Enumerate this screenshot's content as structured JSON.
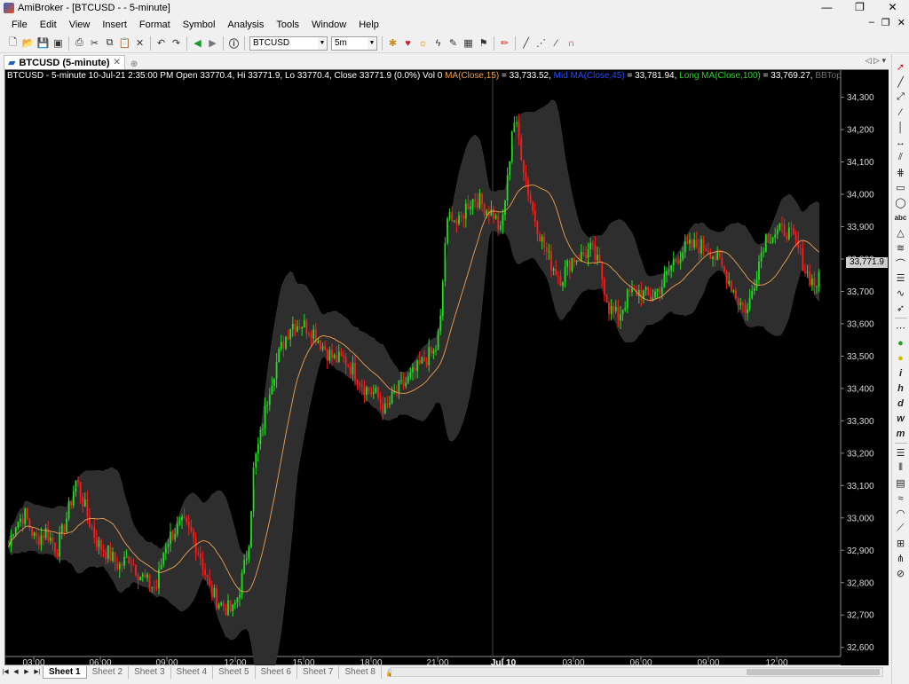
{
  "window": {
    "title": "AmiBroker - [BTCUSD - - 5-minute]",
    "minimize": "—",
    "restore": "❐",
    "close": "✕"
  },
  "menu": [
    "File",
    "Edit",
    "View",
    "Insert",
    "Format",
    "Symbol",
    "Analysis",
    "Tools",
    "Window",
    "Help"
  ],
  "toolbar": {
    "symbol": "BTCUSD",
    "interval": "5m"
  },
  "doc_tab": {
    "label": "BTCUSD (5-minute)"
  },
  "chart_header": {
    "main": "BTCUSD - 5-minute 10-Jul-21 2:35:00 PM Open 33770.4, Hi 33771.9, Lo 33770.4, Close 33771.9 (0.0%) Vol 0 ",
    "ma_label": "MA(Close,15)",
    "ma_value": " = 33,733.52, ",
    "mid_label": "Mid MA(Close,45)",
    "mid_value": " = 33,781.94, ",
    "long_label": "Long MA(Close,100)",
    "long_value": " = 33,769.27, ",
    "bb_label": "BBTop(Clos",
    "colors": {
      "main": "#ffffff",
      "ma": "#f0a050",
      "mid": "#2a4cff",
      "long": "#30d030",
      "bb": "#707070"
    }
  },
  "price_tag": "33,771.9",
  "chart_data": {
    "type": "candlestick",
    "symbol": "BTCUSD",
    "interval": "5-minute",
    "y_ticks": [
      "34,300",
      "34,200",
      "34,100",
      "34,000",
      "33,900",
      "33,800",
      "33,700",
      "33,600",
      "33,500",
      "33,400",
      "33,300",
      "33,200",
      "33,100",
      "33,000",
      "32,900",
      "32,800",
      "32,700",
      "32,600"
    ],
    "ylim": [
      32580,
      34340
    ],
    "x_ticks": [
      "03:00",
      "06:00",
      "09:00",
      "12:00",
      "15:00",
      "18:00",
      "21:00",
      "Jul 10",
      "03:00",
      "06:00",
      "09:00",
      "12:00"
    ],
    "close_path": [
      [
        0,
        32870
      ],
      [
        10,
        32980
      ],
      [
        22,
        33010
      ],
      [
        34,
        32930
      ],
      [
        46,
        32960
      ],
      [
        58,
        32900
      ],
      [
        70,
        33010
      ],
      [
        80,
        33120
      ],
      [
        92,
        33010
      ],
      [
        104,
        32920
      ],
      [
        116,
        32890
      ],
      [
        128,
        32850
      ],
      [
        140,
        32880
      ],
      [
        150,
        32830
      ],
      [
        160,
        32800
      ],
      [
        170,
        32780
      ],
      [
        180,
        32920
      ],
      [
        190,
        32960
      ],
      [
        200,
        32980
      ],
      [
        210,
        32950
      ],
      [
        220,
        32880
      ],
      [
        230,
        32780
      ],
      [
        240,
        32740
      ],
      [
        250,
        32720
      ],
      [
        256,
        32710
      ],
      [
        262,
        32760
      ],
      [
        268,
        32830
      ],
      [
        274,
        32920
      ],
      [
        280,
        33160
      ],
      [
        288,
        33260
      ],
      [
        298,
        33410
      ],
      [
        310,
        33520
      ],
      [
        322,
        33600
      ],
      [
        334,
        33600
      ],
      [
        346,
        33580
      ],
      [
        358,
        33530
      ],
      [
        370,
        33490
      ],
      [
        382,
        33490
      ],
      [
        394,
        33450
      ],
      [
        406,
        33400
      ],
      [
        418,
        33380
      ],
      [
        428,
        33330
      ],
      [
        440,
        33390
      ],
      [
        452,
        33420
      ],
      [
        464,
        33460
      ],
      [
        476,
        33500
      ],
      [
        484,
        33510
      ],
      [
        490,
        33600
      ],
      [
        496,
        33880
      ],
      [
        502,
        33950
      ],
      [
        510,
        33900
      ],
      [
        520,
        33970
      ],
      [
        530,
        33990
      ],
      [
        540,
        33960
      ],
      [
        550,
        33940
      ],
      [
        558,
        33880
      ],
      [
        566,
        34050
      ],
      [
        572,
        34240
      ],
      [
        578,
        34180
      ],
      [
        586,
        34050
      ],
      [
        594,
        33950
      ],
      [
        604,
        33860
      ],
      [
        614,
        33790
      ],
      [
        626,
        33740
      ],
      [
        638,
        33800
      ],
      [
        650,
        33810
      ],
      [
        660,
        33830
      ],
      [
        670,
        33770
      ],
      [
        680,
        33650
      ],
      [
        690,
        33620
      ],
      [
        702,
        33690
      ],
      [
        714,
        33700
      ],
      [
        726,
        33680
      ],
      [
        740,
        33720
      ],
      [
        752,
        33790
      ],
      [
        764,
        33830
      ],
      [
        776,
        33840
      ],
      [
        790,
        33840
      ],
      [
        804,
        33790
      ],
      [
        816,
        33730
      ],
      [
        826,
        33670
      ],
      [
        836,
        33640
      ],
      [
        846,
        33760
      ],
      [
        856,
        33870
      ],
      [
        868,
        33880
      ],
      [
        880,
        33890
      ],
      [
        892,
        33840
      ],
      [
        902,
        33760
      ],
      [
        912,
        33720
      ],
      [
        918,
        33740
      ]
    ]
  },
  "sheets": [
    "Sheet 1",
    "Sheet 2",
    "Sheet 3",
    "Sheet 4",
    "Sheet 5",
    "Sheet 6",
    "Sheet 7",
    "Sheet 8"
  ]
}
